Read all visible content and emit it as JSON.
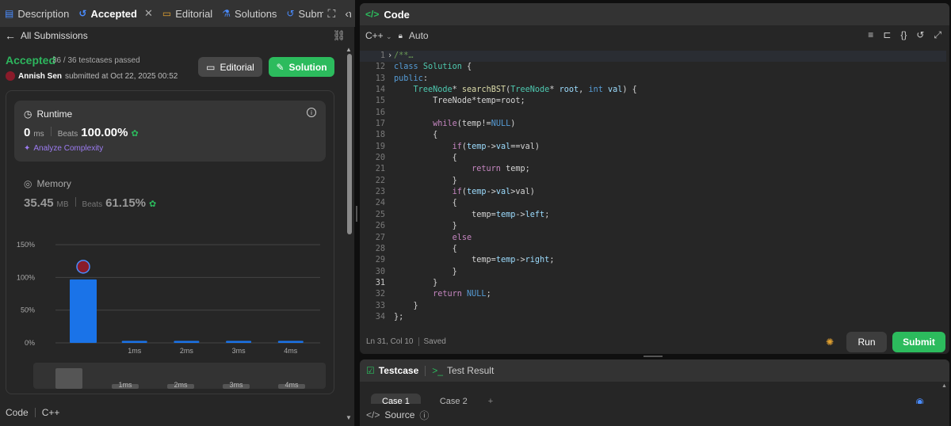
{
  "tabs": [
    {
      "label": "Description",
      "icon": "description-icon"
    },
    {
      "label": "Accepted",
      "icon": "history-icon",
      "active": true
    },
    {
      "label": "Editorial",
      "icon": "book-icon"
    },
    {
      "label": "Solutions",
      "icon": "flask-icon"
    },
    {
      "label": "Submission",
      "icon": "history-icon"
    }
  ],
  "subhead": {
    "back_label": "All Submissions"
  },
  "submission": {
    "status": "Accepted",
    "passed": "36 / 36 testcases passed",
    "author": "Annish Sen",
    "submitted_text": "submitted at Oct 22, 2025 00:52"
  },
  "buttons": {
    "editorial": "Editorial",
    "solution": "Solution"
  },
  "runtime": {
    "title": "Runtime",
    "value": "0",
    "unit": "ms",
    "beats_label": "Beats",
    "beats_value": "100.00%",
    "analyze": "Analyze Complexity"
  },
  "memory": {
    "title": "Memory",
    "value": "35.45",
    "unit": "MB",
    "beats_label": "Beats",
    "beats_value": "61.15%"
  },
  "chart_data": {
    "type": "bar",
    "categories": [
      "0ms",
      "1ms",
      "2ms",
      "3ms",
      "4ms"
    ],
    "category_labels": [
      "",
      "1ms",
      "2ms",
      "3ms",
      "4ms"
    ],
    "values": [
      97,
      3,
      3,
      3,
      3
    ],
    "y_ticks": [
      "150%",
      "100%",
      "50%",
      "0%"
    ],
    "ylim": [
      0,
      150
    ],
    "highlight_index": 0,
    "bar_color": "#1a73e8",
    "mini_labels": [
      "1ms",
      "2ms",
      "3ms",
      "4ms"
    ]
  },
  "bottom_tabs": {
    "code": "Code",
    "lang": "C++"
  },
  "code": {
    "title": "Code",
    "language": "C++",
    "mode": "Auto",
    "lines": [
      {
        "n": "1",
        "html": "<span class='cm'>/**…</span>",
        "fold": true
      },
      {
        "n": "12",
        "html": "<span class='kw'>class</span> <span class='ty'>Solution</span> {"
      },
      {
        "n": "13",
        "html": "<span class='kw'>public</span>:"
      },
      {
        "n": "14",
        "html": "    <span class='ty'>TreeNode</span>* <span class='fn'>searchBST</span>(<span class='ty'>TreeNode</span>* <span class='va'>root</span>, <span class='kw'>int</span> <span class='va'>val</span>) {"
      },
      {
        "n": "15",
        "html": "        TreeNode*temp=root;"
      },
      {
        "n": "16",
        "html": ""
      },
      {
        "n": "17",
        "html": "        <span class='kw2'>while</span>(temp!=<span class='kw'>NULL</span>)"
      },
      {
        "n": "18",
        "html": "        {"
      },
      {
        "n": "19",
        "html": "            <span class='kw2'>if</span>(<span class='va'>temp</span>-><span class='va'>val</span>==val)"
      },
      {
        "n": "20",
        "html": "            {"
      },
      {
        "n": "21",
        "html": "                <span class='kw2'>return</span> temp;"
      },
      {
        "n": "22",
        "html": "            }"
      },
      {
        "n": "23",
        "html": "            <span class='kw2'>if</span>(<span class='va'>temp</span>-><span class='va'>val</span>>val)"
      },
      {
        "n": "24",
        "html": "            {"
      },
      {
        "n": "25",
        "html": "                temp=<span class='va'>temp</span>-><span class='va'>left</span>;"
      },
      {
        "n": "26",
        "html": "            }"
      },
      {
        "n": "27",
        "html": "            <span class='kw2'>else</span>"
      },
      {
        "n": "28",
        "html": "            {"
      },
      {
        "n": "29",
        "html": "                temp=<span class='va'>temp</span>-><span class='va'>right</span>;"
      },
      {
        "n": "30",
        "html": "            }"
      },
      {
        "n": "31",
        "html": "        }",
        "current": true
      },
      {
        "n": "32",
        "html": "        <span class='kw2'>return</span> <span class='kw'>NULL</span>;"
      },
      {
        "n": "33",
        "html": "    }"
      },
      {
        "n": "34",
        "html": "};"
      }
    ],
    "cursor": "Ln 31, Col 10",
    "saved": "Saved",
    "run": "Run",
    "submit": "Submit"
  },
  "testcase": {
    "tab": "Testcase",
    "result_tab": "Test Result",
    "cases": [
      "Case 1",
      "Case 2"
    ],
    "add": "+",
    "source": "Source"
  }
}
